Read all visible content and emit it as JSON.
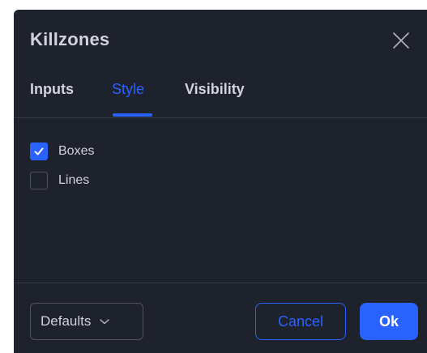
{
  "dialog": {
    "title": "Killzones"
  },
  "tabs": [
    {
      "label": "Inputs",
      "active": false
    },
    {
      "label": "Style",
      "active": true
    },
    {
      "label": "Visibility",
      "active": false
    }
  ],
  "options": [
    {
      "label": "Boxes",
      "checked": true
    },
    {
      "label": "Lines",
      "checked": false
    }
  ],
  "footer": {
    "defaults_label": "Defaults",
    "cancel_label": "Cancel",
    "ok_label": "Ok"
  },
  "colors": {
    "background": "#1e222d",
    "accent": "#2962ff",
    "text": "#d1d4dc",
    "border": "#50535e",
    "divider": "#363a45"
  },
  "icons": {
    "close": "close-icon",
    "check": "checkmark-icon",
    "dropdown": "chevron-down-icon"
  }
}
